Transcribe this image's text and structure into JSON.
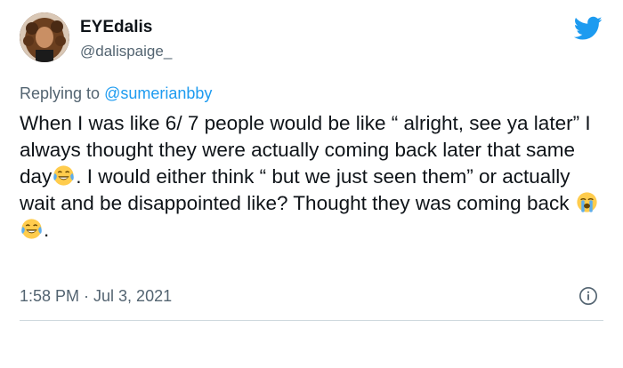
{
  "author": {
    "display_name": "EYEdalis",
    "handle": "@dalispaige_",
    "avatar_icon": "profile-photo"
  },
  "brand": {
    "icon": "twitter-bird-icon",
    "color": "#1d9bf0"
  },
  "reply": {
    "prefix": "Replying to",
    "mention": "@sumerianbby"
  },
  "tweet": {
    "text_part_1": "When I was like 6/ 7 people would be like “ alright, see ya later” I always thought they were actually coming back later that same day",
    "emoji_1": "face-with-tears-of-joy",
    "text_part_2": ". I would either think “ but we just seen them” or actually wait and be disappointed like? Thought they was coming back ",
    "emoji_2": "loudly-crying-face",
    "emoji_3": "face-with-tears-of-joy",
    "text_part_3": "."
  },
  "meta": {
    "timestamp": "1:58 PM · Jul 3, 2021"
  }
}
